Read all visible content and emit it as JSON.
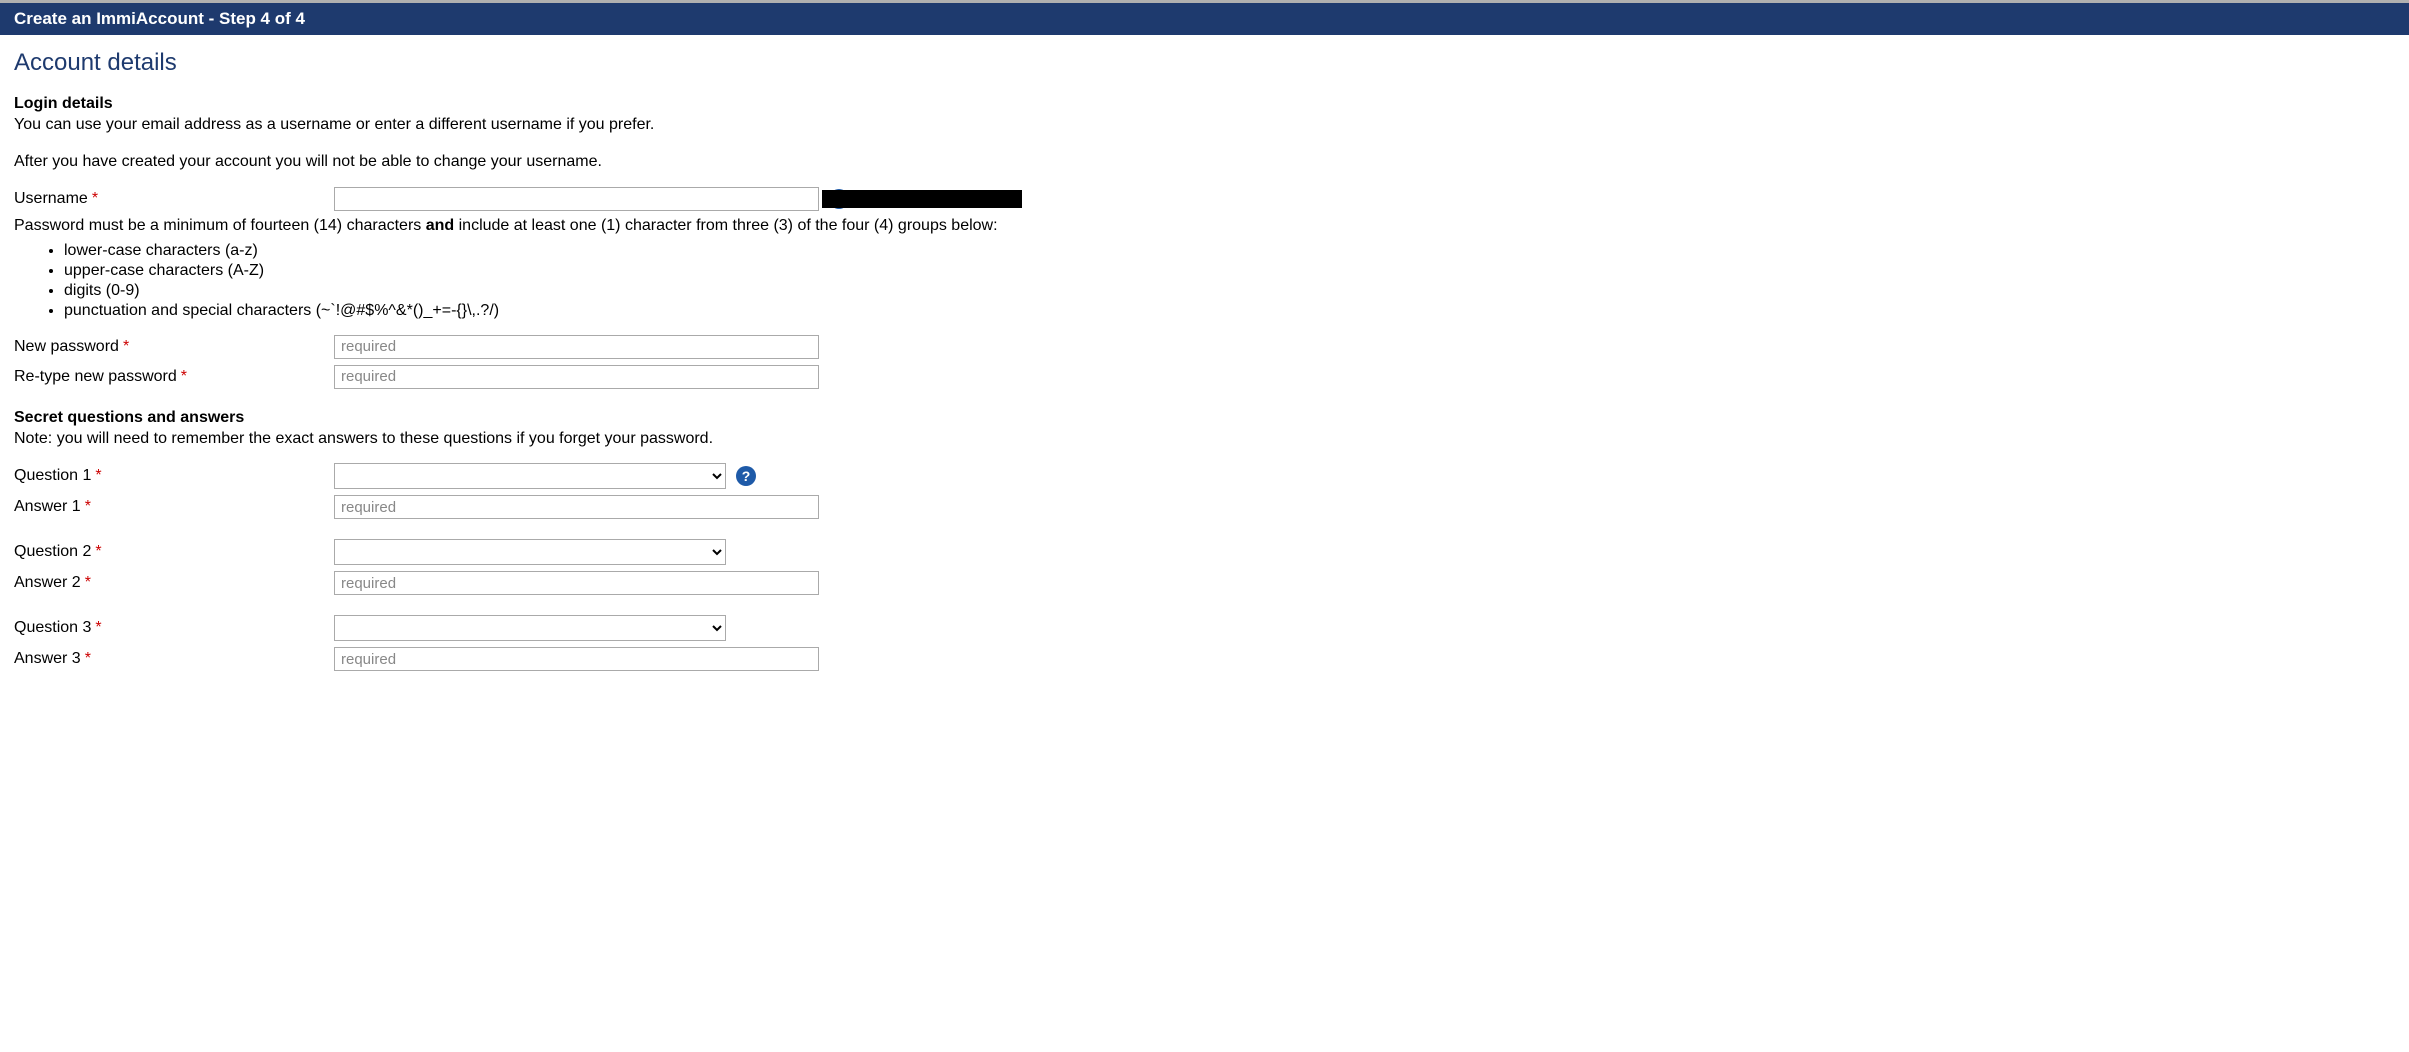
{
  "header": {
    "title": "Create an ImmiAccount - Step 4 of 4"
  },
  "page_title": "Account details",
  "login_details": {
    "heading": "Login details",
    "intro1": "You can use your email address as a username or enter a different username if you prefer.",
    "intro2": "After you have created your account you will not be able to change your username."
  },
  "username": {
    "label": "Username",
    "value": ""
  },
  "password_rules": {
    "intro_before_and": "Password must be a minimum of fourteen (14) characters ",
    "and": "and",
    "intro_after_and": " include at least one (1) character from three (3) of the four (4) groups below:",
    "items": [
      "lower-case characters (a-z)",
      "upper-case characters (A-Z)",
      "digits (0-9)",
      "punctuation and special characters (~`!@#$%^&*()_+=-{}\\,.?/)"
    ]
  },
  "new_password_label": "New password",
  "retype_password_label": "Re-type new password",
  "password_placeholder": "required",
  "secret": {
    "heading": "Secret questions and answers",
    "note": "Note: you will need to remember the exact answers to these questions if you forget your password."
  },
  "q1_label": "Question 1",
  "a1_label": "Answer 1",
  "q2_label": "Question 2",
  "a2_label": "Answer 2",
  "q3_label": "Question 3",
  "a3_label": "Answer 3",
  "answer_placeholder": "required"
}
